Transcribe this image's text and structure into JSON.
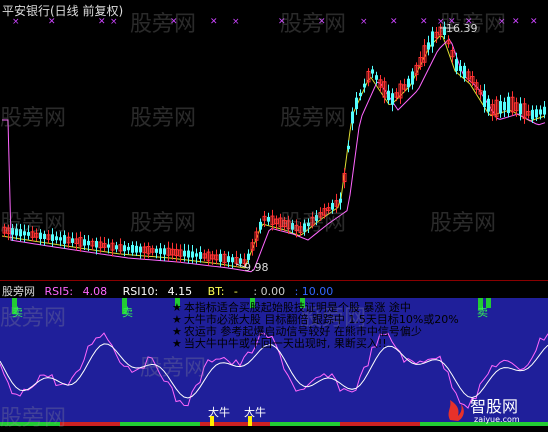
{
  "title": "平安银行(日线 前复权)",
  "price_labels": {
    "high": "16.39",
    "low": "9.98"
  },
  "watermark": "股旁网",
  "indicator_header": {
    "source": "股旁网",
    "rsi5_label": "RSI5:",
    "rsi5_value": "4.08",
    "rsi10_label": "RSI10:",
    "rsi10_value": "4.15",
    "bt_label": "BT:",
    "bt_value": "-",
    "value_a": ": 0.00",
    "value_b": ": 10.00"
  },
  "notes": [
    {
      "star": "★",
      "text": "本指标适合买股起始股技证明是个股 暴涨 途中",
      "color": "#ff3366"
    },
    {
      "star": "★",
      "text": "大牛市必涨大股 目标翻倍 跟踪中 1.5天目标10%或20%",
      "color": "#ffd000"
    },
    {
      "star": "★",
      "text": "农运市 参考起爆启动信号较好 在熊市中信号偏少",
      "color": "#33ee55"
    },
    {
      "star": "★",
      "text": "当大牛中牛或牛回一天出现时, 果断买入!!",
      "color": "#ffffff"
    }
  ],
  "signals": {
    "sell": "卖",
    "bull": "大牛"
  },
  "logo": {
    "cn": "智股网",
    "url": "zaiyue.com"
  },
  "colors": {
    "up": "#ff3232",
    "down": "#54ffff",
    "rsi5": "#ff66ff",
    "rsi10": "#ffffff",
    "panel_bg": "#1f1f9a"
  }
}
